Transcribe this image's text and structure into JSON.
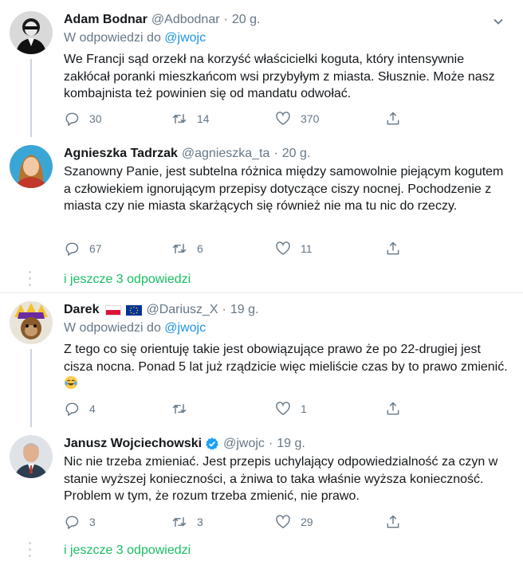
{
  "colors": {
    "text": "#14171a",
    "muted": "#657786",
    "link": "#1b95e0",
    "green_link": "#17bf63",
    "divider": "#e6ecf0",
    "thread_line": "#ccd6dd"
  },
  "tweets": [
    {
      "name": "Adam Bodnar",
      "handle": "@Adbodnar",
      "dot": "·",
      "time": "20 g.",
      "reply_prefix": "W odpowiedzi do",
      "reply_mention": "@jwojc",
      "text": "We Francji sąd orzekł na korzyść właścicielki koguta, który intensywnie zakłócał poranki mieszkańcom wsi przybyłym z miasta. Słusznie. Może nasz kombajnista też powinien się od mandatu odwołać.",
      "replies": "30",
      "retweets": "14",
      "likes": "370"
    },
    {
      "name": "Agnieszka Tadrzak",
      "handle": "@agnieszka_ta",
      "dot": "·",
      "time": "20 g.",
      "text": "Szanowny Panie, jest subtelna różnica między samowolnie piejącym kogutem a człowiekiem ignorującym przepisy dotyczące ciszy nocnej. Pochodzenie z miasta czy nie miasta skarżących się również nie ma tu nic do rzeczy.",
      "replies": "67",
      "retweets": "6",
      "likes": "11"
    },
    {
      "name": "Darek",
      "handle": "@Dariusz_X",
      "dot": "·",
      "time": "19 g.",
      "reply_prefix": "W odpowiedzi do",
      "reply_mention": "@jwojc",
      "text": "Z tego co się orientuję takie jest obowiązujące prawo że po 22-drugiej jest cisza nocna. Ponad 5 lat już rządzicie więc mieliście czas by to prawo zmienić.",
      "replies": "4",
      "retweets": "",
      "likes": "1"
    },
    {
      "name": "Janusz Wojciechowski",
      "handle": "@jwojc",
      "dot": "·",
      "time": "19 g.",
      "text": "Nic nie trzeba zmieniać. Jest przepis uchylający odpowiedzialność za czyn w stanie wyższej konieczności, a żniwa to taka właśnie wyższa konieczność. Problem w tym, że rozum trzeba zmienić, nie prawo.",
      "replies": "3",
      "retweets": "3",
      "likes": "29"
    }
  ],
  "more_replies_1": "i jeszcze 3 odpowiedzi",
  "more_replies_2": "i jeszcze 3 odpowiedzi",
  "icons": {
    "reply": "reply-icon",
    "retweet": "retweet-icon",
    "like": "like-icon",
    "share": "share-icon",
    "caret": "chevron-down-icon",
    "verified": "verified-badge-icon",
    "emoji": "tears-of-joy-emoji-icon",
    "flag_pl": "poland-flag-icon",
    "flag_eu": "eu-flag-icon"
  }
}
